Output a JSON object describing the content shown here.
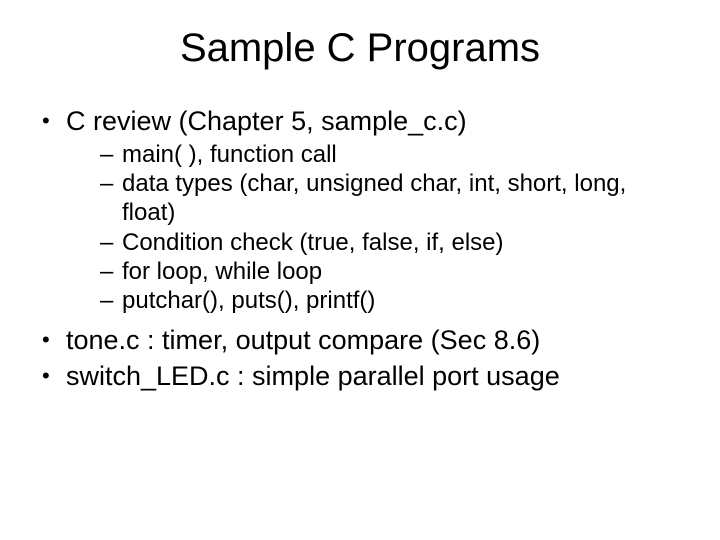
{
  "title": "Sample C Programs",
  "bullets": {
    "b0": {
      "text": "C review (Chapter 5, sample_c.c)",
      "sub": {
        "s0": "main( ), function call",
        "s1": "data types (char, unsigned char, int, short, long, float)",
        "s2": "Condition check (true, false, if, else)",
        "s3": "for loop, while loop",
        "s4": "putchar(), puts(), printf()"
      }
    },
    "b1": {
      "text": "tone.c : timer, output compare (Sec 8.6)"
    },
    "b2": {
      "text": "switch_LED.c : simple parallel port usage"
    }
  }
}
